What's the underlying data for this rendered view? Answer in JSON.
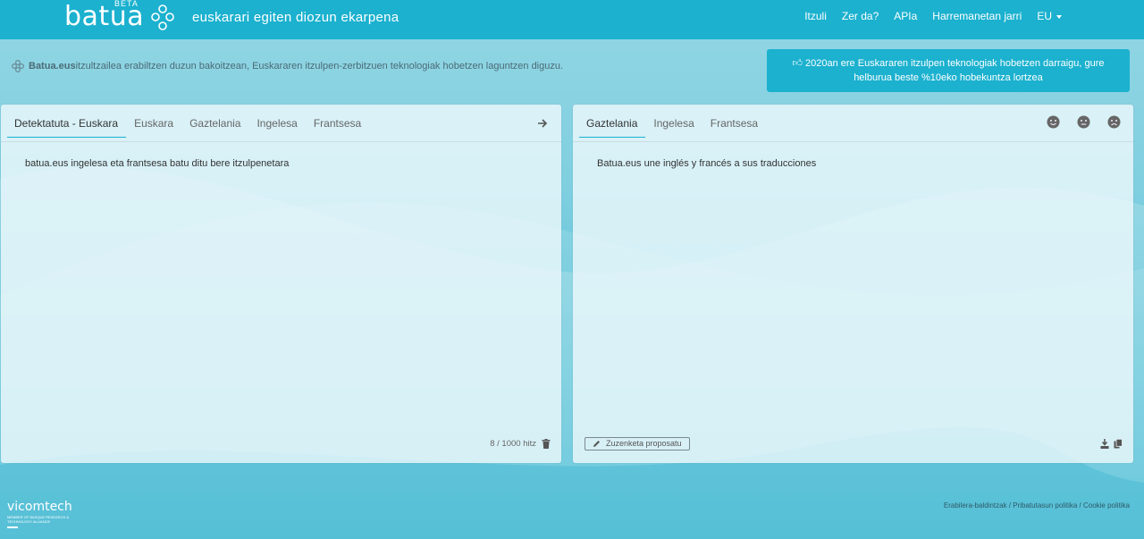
{
  "header": {
    "logo_text": "batua",
    "logo_badge": "BETA",
    "tagline": "euskarari egiten diozun ekarpena",
    "nav": [
      "Itzuli",
      "Zer da?",
      "APIa",
      "Harremanetan jarri"
    ],
    "language": "EU"
  },
  "info": {
    "brand": "Batua.eus",
    "text": " itzultzailea erabiltzen duzun bakoitzean, Euskararen itzulpen-zerbitzuen teknologiak hobetzen laguntzen diguzu."
  },
  "banner": {
    "line1": "2020an ere Euskararen itzulpen teknologiak hobetzen darraigu, gure",
    "line2": "helburua beste %10eko hobekuntza lortzea"
  },
  "source": {
    "tabs": [
      "Detektatuta - Euskara",
      "Euskara",
      "Gaztelania",
      "Ingelesa",
      "Frantsesa"
    ],
    "active_tab": 0,
    "text": "batua.eus ingelesa eta frantsesa batu ditu bere itzulpenetara",
    "counter": "8 / 1000 hitz"
  },
  "target": {
    "tabs": [
      "Gaztelania",
      "Ingelesa",
      "Frantsesa"
    ],
    "active_tab": 0,
    "text": "Batua.eus une inglés y francés a sus traducciones",
    "propose_label": "Zuzenketa proposatu"
  },
  "footer": {
    "brand": "vicomtech",
    "brand_sub": "MEMBER OF BASQUE RESEARCH & TECHNOLOGY ALLIANCE",
    "links": [
      "Erabilera-baldintzak",
      "Pribatutasun politika",
      "Cookie politika"
    ],
    "separator": " / "
  },
  "colors": {
    "accent": "#1bb1cf",
    "panel_bg": "#ebf8fb"
  }
}
